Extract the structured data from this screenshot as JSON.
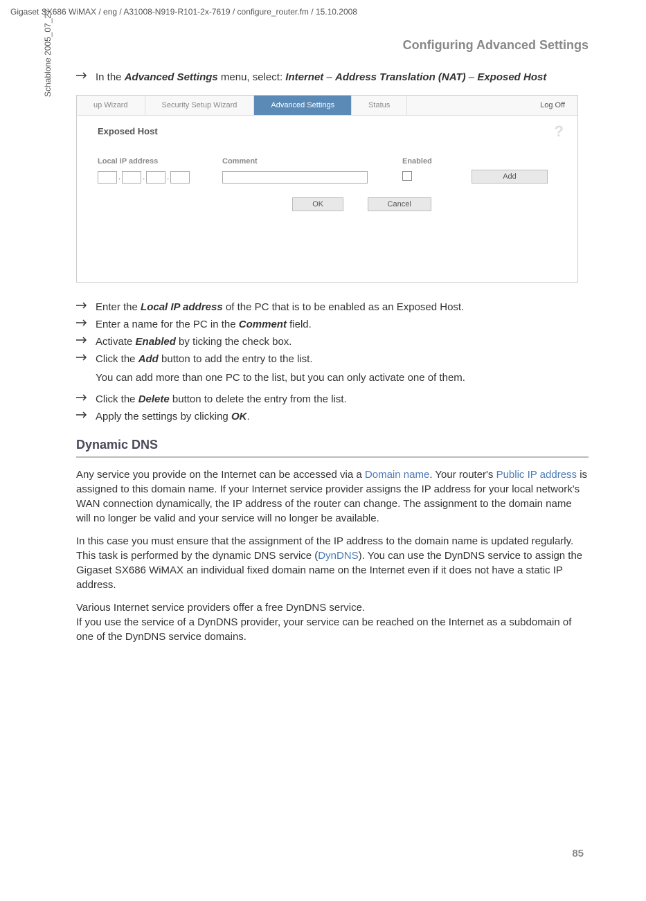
{
  "header_path": "Gigaset SX686 WiMAX / eng / A31008-N919-R101-2x-7619 / configure_router.fm / 15.10.2008",
  "side_label": "Schablone 2005_07_27",
  "section_header": "Configuring Advanced Settings",
  "page_number": "85",
  "intro": {
    "prefix": "In the ",
    "bold1": "Advanced Settings",
    "mid1": " menu, select: ",
    "bold2": "Internet",
    "sep1": " – ",
    "bold3": "Address Translation (NAT)",
    "sep2": " – ",
    "bold4": "Exposed Host"
  },
  "screenshot": {
    "nav": {
      "item0": "up Wizard",
      "item1": "Security Setup Wizard",
      "item2": "Advanced Settings",
      "item3": "Status",
      "logoff": "Log Off"
    },
    "title": "Exposed Host",
    "help": "?",
    "labels": {
      "ip": "Local IP address",
      "comment": "Comment",
      "enabled": "Enabled"
    },
    "buttons": {
      "add": "Add",
      "ok": "OK",
      "cancel": "Cancel"
    }
  },
  "bullets": {
    "b1_pre": "Enter the ",
    "b1_bold": "Local IP address",
    "b1_post": " of the PC that is to be enabled as an Exposed Host.",
    "b2_pre": "Enter a name for the PC in the ",
    "b2_bold": "Comment",
    "b2_post": " field.",
    "b3_pre": "Activate ",
    "b3_bold": "Enabled",
    "b3_post": " by ticking the check box.",
    "b4_pre": "Click the ",
    "b4_bold": "Add",
    "b4_post": " button to add the entry to the list.",
    "b4_sub": "You can add more than one PC to the list, but you can only activate one of them.",
    "b5_pre": "Click the ",
    "b5_bold": "Delete",
    "b5_post": " button to delete the entry from the list.",
    "b6_pre": "Apply the settings by clicking ",
    "b6_bold": "OK",
    "b6_post": "."
  },
  "dns": {
    "title": "Dynamic DNS",
    "p1_a": "Any service you provide on the Internet can be accessed via a ",
    "p1_link1": "Domain name",
    "p1_b": ". Your router's ",
    "p1_link2": "Public IP address",
    "p1_c": " is assigned to this domain name. If your Internet service provider assigns the IP address for your local network's WAN connection dynamically, the IP address of the router can change. The assignment to the domain name will no longer be valid and your service will no longer be available.",
    "p2_a": "In this case you must ensure that the assignment of the IP address to the domain name is updated regularly. This task is performed by the dynamic DNS service (",
    "p2_link": "DynDNS",
    "p2_b": "). You can use the DynDNS service to assign the Gigaset SX686 WiMAX an individual fixed domain name on the Internet even if it does not have a static IP address.",
    "p3": "Various Internet service providers offer a free DynDNS service.\nIf you use the service of a DynDNS provider, your service can be reached on the Internet as a subdomain of one of the DynDNS service domains."
  }
}
